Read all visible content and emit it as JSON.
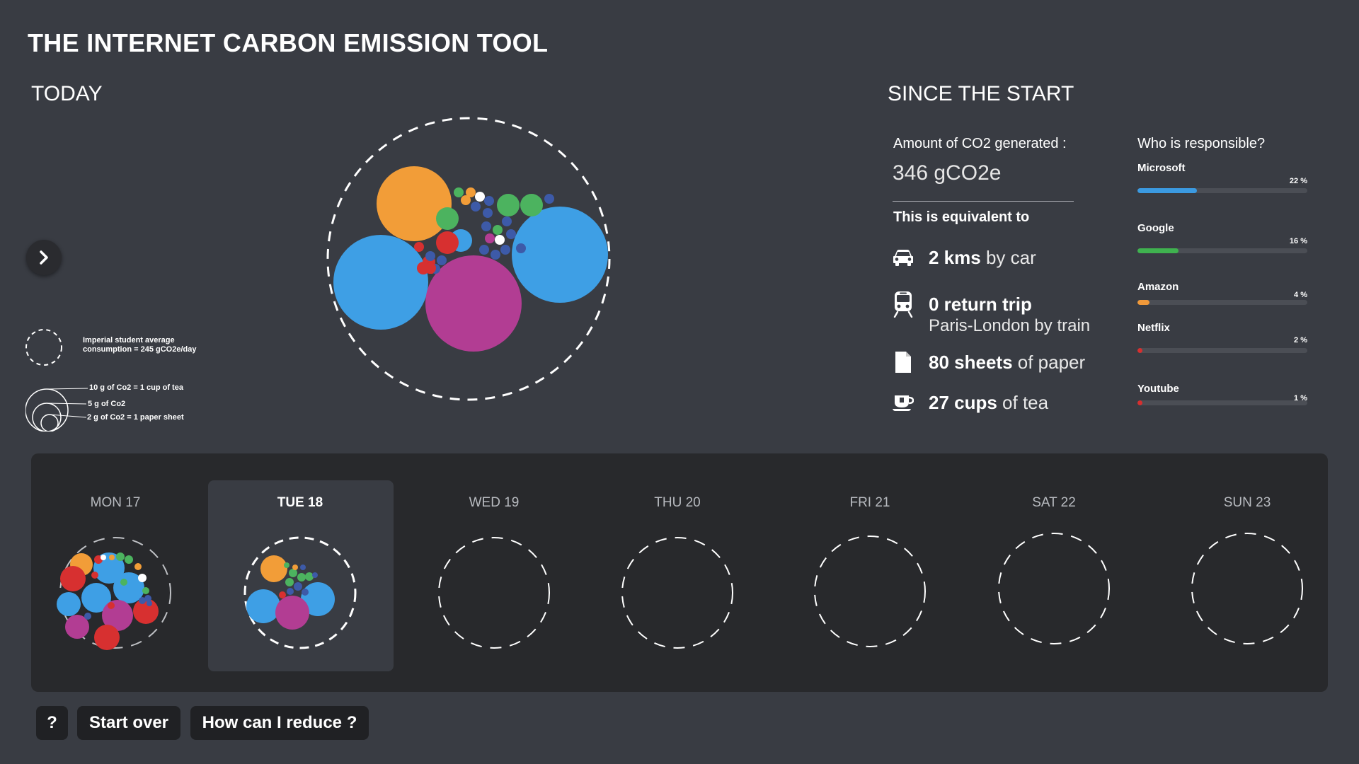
{
  "app": {
    "title": "THE INTERNET CARBON EMISSION TOOL"
  },
  "today": {
    "heading": "TODAY"
  },
  "legend": {
    "average_line1": "Imperial student average",
    "average_line2": "consumption = 245 gCO2e/day",
    "scale_10": "10 g of Co2 = 1 cup of tea",
    "scale_5": "5 g of Co2",
    "scale_2": "2 g of Co2 = 1 paper sheet"
  },
  "since": {
    "heading": "SINCE THE START",
    "amount_label": "Amount of CO2 generated :",
    "amount_value": "346 gCO2e",
    "equivalent_heading": "This is equivalent to",
    "equivalents": [
      {
        "icon": "car-icon",
        "number": "2 kms",
        "unit": " by car",
        "sub": ""
      },
      {
        "icon": "train-icon",
        "number": "0 return trip",
        "unit": "",
        "sub": "Paris-London by train"
      },
      {
        "icon": "paper-sheet-icon",
        "number": "80 sheets",
        "unit": " of paper",
        "sub": ""
      },
      {
        "icon": "tea-cup-icon",
        "number": "27 cups",
        "unit": " of tea",
        "sub": ""
      }
    ]
  },
  "responsible": {
    "heading": "Who is responsible?",
    "items": [
      {
        "name": "Microsoft",
        "percent_label": "22 %",
        "fill_fraction": 0.35,
        "color": "#3b9ae1"
      },
      {
        "name": "Google",
        "percent_label": "16 %",
        "fill_fraction": 0.24,
        "color": "#3fb24f"
      },
      {
        "name": "Amazon",
        "percent_label": "4 %",
        "fill_fraction": 0.07,
        "color": "#f0993a"
      },
      {
        "name": "Netflix",
        "percent_label": "2 %",
        "fill_fraction": 0.03,
        "color": "#d62f2f"
      },
      {
        "name": "Youtube",
        "percent_label": "1 %",
        "fill_fraction": 0.03,
        "color": "#d62f2f"
      }
    ]
  },
  "week": {
    "days": [
      {
        "label": "MON 17",
        "selected": false,
        "filled": true
      },
      {
        "label": "TUE 18",
        "selected": true,
        "filled": true
      },
      {
        "label": "WED 19",
        "selected": false,
        "filled": false
      },
      {
        "label": "THU 20",
        "selected": false,
        "filled": false
      },
      {
        "label": "FRI 21",
        "selected": false,
        "filled": false
      },
      {
        "label": "SAT 22",
        "selected": false,
        "filled": false
      },
      {
        "label": "SUN 23",
        "selected": false,
        "filled": false
      }
    ]
  },
  "buttons": {
    "help": "?",
    "start_over": "Start over",
    "reduce": "How can I reduce ?"
  },
  "colors": {
    "background": "#393c43",
    "panel": "#28292c",
    "orange": "#f29d38",
    "blue": "#3e9fe5",
    "magenta": "#b23d93",
    "green": "#4cb35f",
    "red": "#d73030",
    "navy": "#3d5aa8",
    "white": "#ffffff"
  }
}
